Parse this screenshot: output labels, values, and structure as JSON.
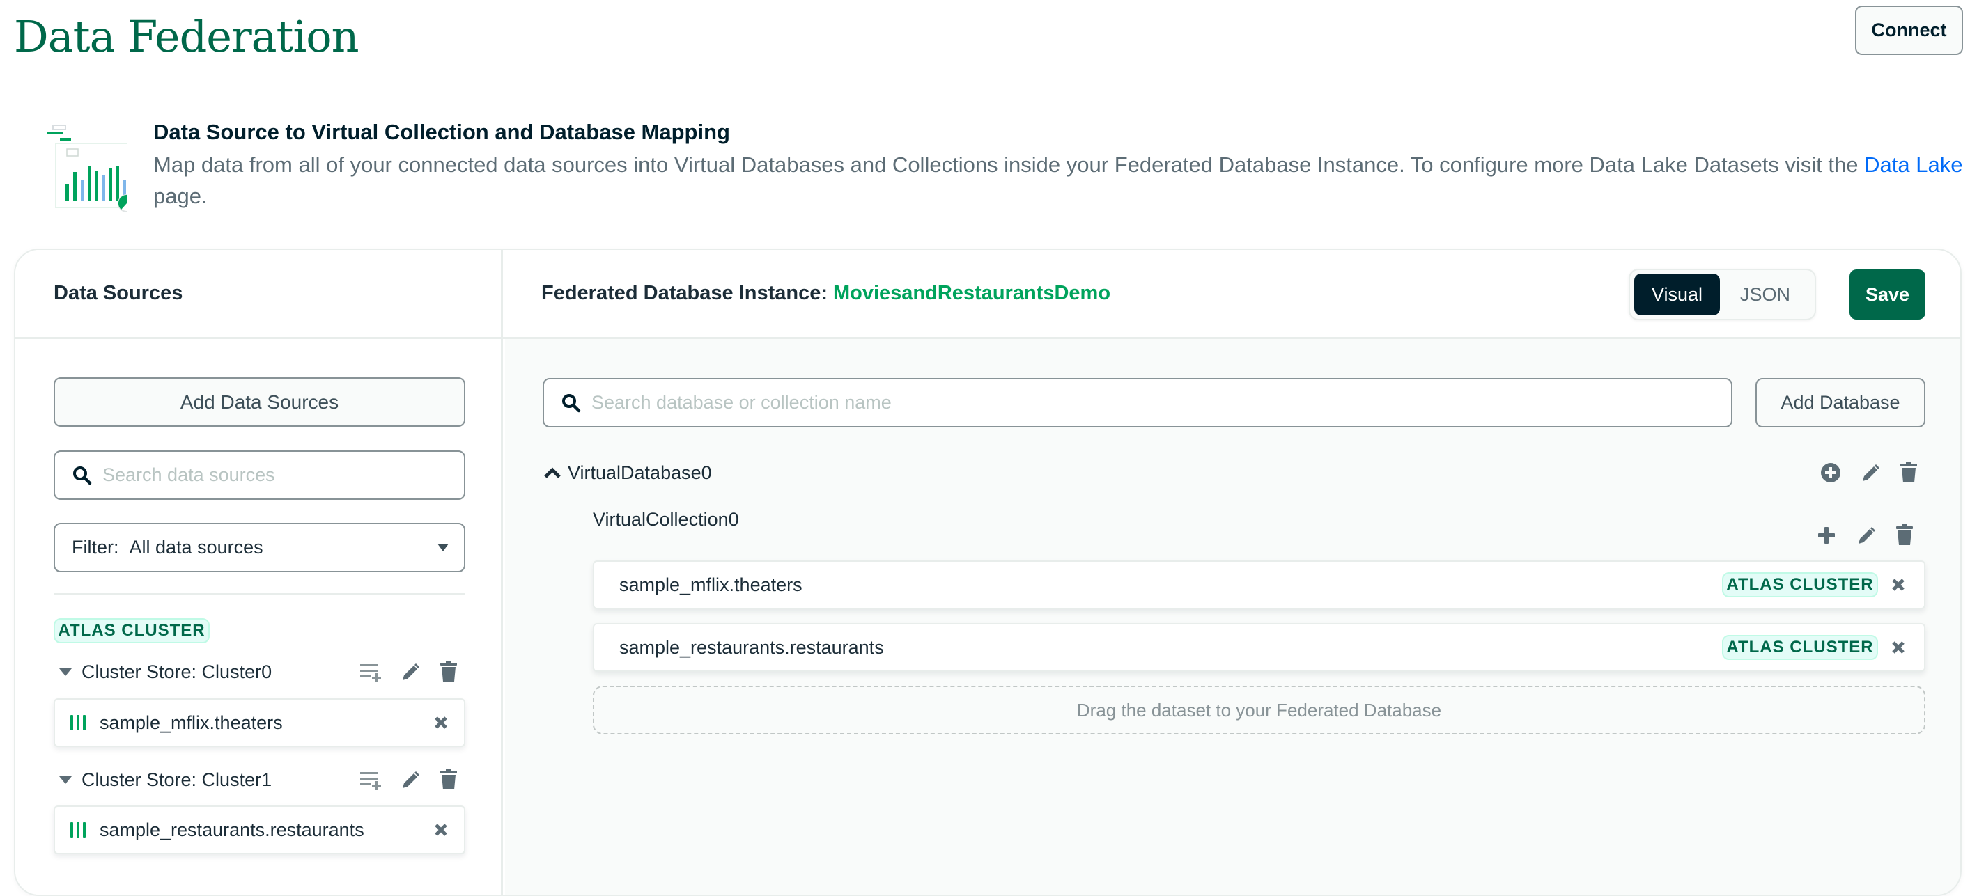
{
  "header": {
    "title": "Data Federation",
    "connect_label": "Connect"
  },
  "banner": {
    "illustration_icon": "chart-illustration",
    "title": "Data Source to Virtual Collection and Database Mapping",
    "text_before_link": "Map data from all of your connected data sources into Virtual Databases and Collections inside your Federated Database Instance. To configure more Data Lake Datasets visit the ",
    "link_text": "Data Lake",
    "text_after_link": " page."
  },
  "data_sources": {
    "title": "Data Sources",
    "add_button_label": "Add Data Sources",
    "search_placeholder": "Search data sources",
    "filter_label": "Filter:",
    "filter_value": "All data sources",
    "group_badge": "ATLAS CLUSTER",
    "clusters": [
      {
        "label": "Cluster Store: Cluster0",
        "datasets": [
          "sample_mflix.theaters"
        ]
      },
      {
        "label": "Cluster Store: Cluster1",
        "datasets": [
          "sample_restaurants.restaurants"
        ]
      }
    ]
  },
  "federated": {
    "label": "Federated Database Instance:",
    "instance_name": "MoviesandRestaurantsDemo",
    "view_toggle": {
      "options": [
        "Visual",
        "JSON"
      ],
      "selected": "Visual"
    },
    "save_label": "Save",
    "search_placeholder": "Search database or collection name",
    "add_database_label": "Add Database",
    "database": {
      "name": "VirtualDatabase0",
      "expanded": true,
      "collection": {
        "name": "VirtualCollection0",
        "mapped_datasets": [
          {
            "name": "sample_mflix.theaters",
            "type": "ATLAS CLUSTER"
          },
          {
            "name": "sample_restaurants.restaurants",
            "type": "ATLAS CLUSTER"
          }
        ],
        "drop_hint": "Drag the dataset to your Federated Database"
      }
    }
  },
  "colors": {
    "brand_green": "#00684a",
    "accent_green": "#00a35c",
    "link_blue": "#016bf8",
    "dark": "#001e2b",
    "icon_gray": "#5c6c75",
    "badge_bg": "#e3fcf7"
  }
}
